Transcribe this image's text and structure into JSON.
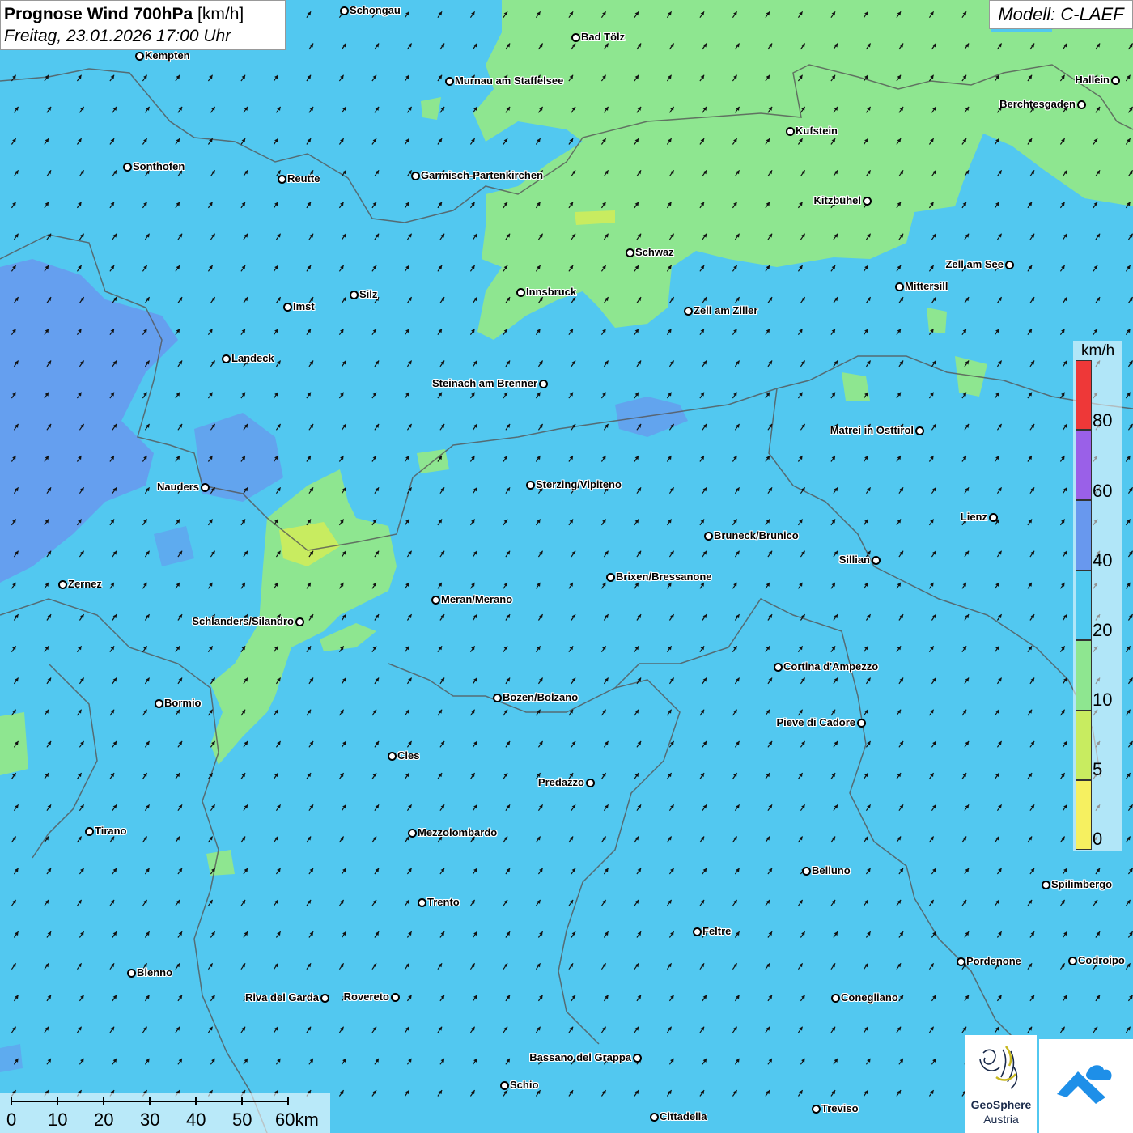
{
  "title": {
    "main": "Prognose Wind 700hPa",
    "unit": "[km/h]",
    "date": "Freitag, 23.01.2026 17:00 Uhr"
  },
  "model": "Modell: C-LAEF",
  "legend": {
    "unit": "km/h",
    "levels": [
      {
        "label": "0",
        "color": "#f6f060"
      },
      {
        "label": "5",
        "color": "#c8ec60"
      },
      {
        "label": "10",
        "color": "#8ee690"
      },
      {
        "label": "20",
        "color": "#4fc9f0"
      },
      {
        "label": "40",
        "color": "#6898ee"
      },
      {
        "label": "60",
        "color": "#9a60e8"
      },
      {
        "label": "80",
        "color": "#ee3838"
      }
    ]
  },
  "scalebar": {
    "labels": [
      "0",
      "10",
      "20",
      "30",
      "40",
      "50",
      "60km"
    ]
  },
  "cities": [
    {
      "name": "Schongau"
    },
    {
      "name": "Bad Tölz"
    },
    {
      "name": "Kempten"
    },
    {
      "name": "Murnau am Staffelsee"
    },
    {
      "name": "Hallein"
    },
    {
      "name": "Berchtesgaden"
    },
    {
      "name": "Kufstein"
    },
    {
      "name": "Sonthofen"
    },
    {
      "name": "Reutte"
    },
    {
      "name": "Garmisch-Partenkirchen"
    },
    {
      "name": "Kitzbühel"
    },
    {
      "name": "Schwaz"
    },
    {
      "name": "Zell am See"
    },
    {
      "name": "Mittersill"
    },
    {
      "name": "Innsbruck"
    },
    {
      "name": "Zell am Ziller"
    },
    {
      "name": "Imst"
    },
    {
      "name": "Silz"
    },
    {
      "name": "Landeck"
    },
    {
      "name": "Steinach am Brenner"
    },
    {
      "name": "Matrei in Osttirol"
    },
    {
      "name": "Nauders"
    },
    {
      "name": "Sterzing/Vipiteno"
    },
    {
      "name": "Lienz"
    },
    {
      "name": "Bruneck/Brunico"
    },
    {
      "name": "Sillian"
    },
    {
      "name": "Zernez"
    },
    {
      "name": "Brixen/Bressanone"
    },
    {
      "name": "Meran/Merano"
    },
    {
      "name": "Schlanders/Silandro"
    },
    {
      "name": "Cortina d'Ampezzo"
    },
    {
      "name": "Bormio"
    },
    {
      "name": "Bozen/Bolzano"
    },
    {
      "name": "Pieve di Cadore"
    },
    {
      "name": "Cles"
    },
    {
      "name": "Predazzo"
    },
    {
      "name": "Tirano"
    },
    {
      "name": "Mezzolombardo"
    },
    {
      "name": "Belluno"
    },
    {
      "name": "Spilimbergo"
    },
    {
      "name": "Trento"
    },
    {
      "name": "Feltre"
    },
    {
      "name": "Bienno"
    },
    {
      "name": "Pordenone"
    },
    {
      "name": "Codroipo"
    },
    {
      "name": "Riva del Garda"
    },
    {
      "name": "Rovereto"
    },
    {
      "name": "Conegliano"
    },
    {
      "name": "Bassano del Grappa"
    },
    {
      "name": "Schio"
    },
    {
      "name": "Treviso"
    },
    {
      "name": "Cittadella"
    }
  ],
  "logos": {
    "geosphere_line1": "GeoSphere",
    "geosphere_line2": "Austria"
  },
  "wind": {
    "direction_deg": 35
  }
}
